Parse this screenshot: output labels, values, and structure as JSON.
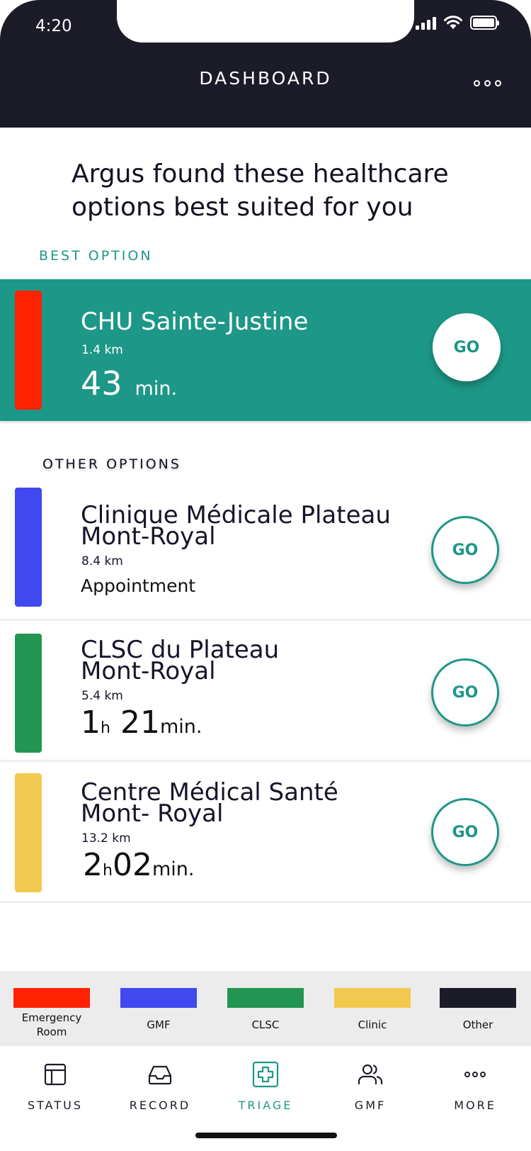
{
  "status_bar": {
    "time": "4:20"
  },
  "header": {
    "title": "DASHBOARD"
  },
  "intro": "Argus found these healthcare options best suited for you",
  "best_section": {
    "label": "BEST OPTION",
    "name": "CHU Sainte-Justine",
    "distance": "1.4 km",
    "wait_value": "43",
    "wait_unit": "min.",
    "category_color": "#ff2200",
    "go_label": "GO"
  },
  "other_section": {
    "label": "OTHER OPTIONS",
    "items": [
      {
        "name_line1": "Clinique Médicale Plateau",
        "name_line2": "Mont-Royal",
        "distance": "8.4 km",
        "detail": "Appointment",
        "category_color": "#4148ef",
        "go_label": "GO"
      },
      {
        "name_line1": "CLSC du Plateau",
        "name_line2": "Mont-Royal",
        "distance": "5.4 km",
        "hours": "1",
        "hours_unit": "h",
        "minutes": "21",
        "minutes_unit": "min.",
        "category_color": "#239553",
        "go_label": "GO"
      },
      {
        "name_line1": "Centre Médical Santé",
        "name_line2": "Mont- Royal",
        "distance": "13.2 km",
        "hours": "2",
        "hours_unit": "h",
        "minutes": "02",
        "minutes_unit": "min.",
        "category_color": "#f2c94f",
        "go_label": "GO"
      }
    ]
  },
  "legend": [
    {
      "label": "Emergency Room",
      "color": "#ff2200"
    },
    {
      "label": "GMF",
      "color": "#4148ef"
    },
    {
      "label": "CLSC",
      "color": "#239553"
    },
    {
      "label": "Clinic",
      "color": "#f2c94f"
    },
    {
      "label": "Other",
      "color": "#1c1c28"
    }
  ],
  "tabs": [
    {
      "label": "STATUS",
      "icon": "layout-icon"
    },
    {
      "label": "RECORD",
      "icon": "inbox-icon"
    },
    {
      "label": "TRIAGE",
      "icon": "medical-cross-icon",
      "active": true
    },
    {
      "label": "GMF",
      "icon": "users-icon"
    },
    {
      "label": "MORE",
      "icon": "more-dots-icon"
    }
  ],
  "colors": {
    "accent": "#1d9787",
    "header_bg": "#1c1c28"
  }
}
